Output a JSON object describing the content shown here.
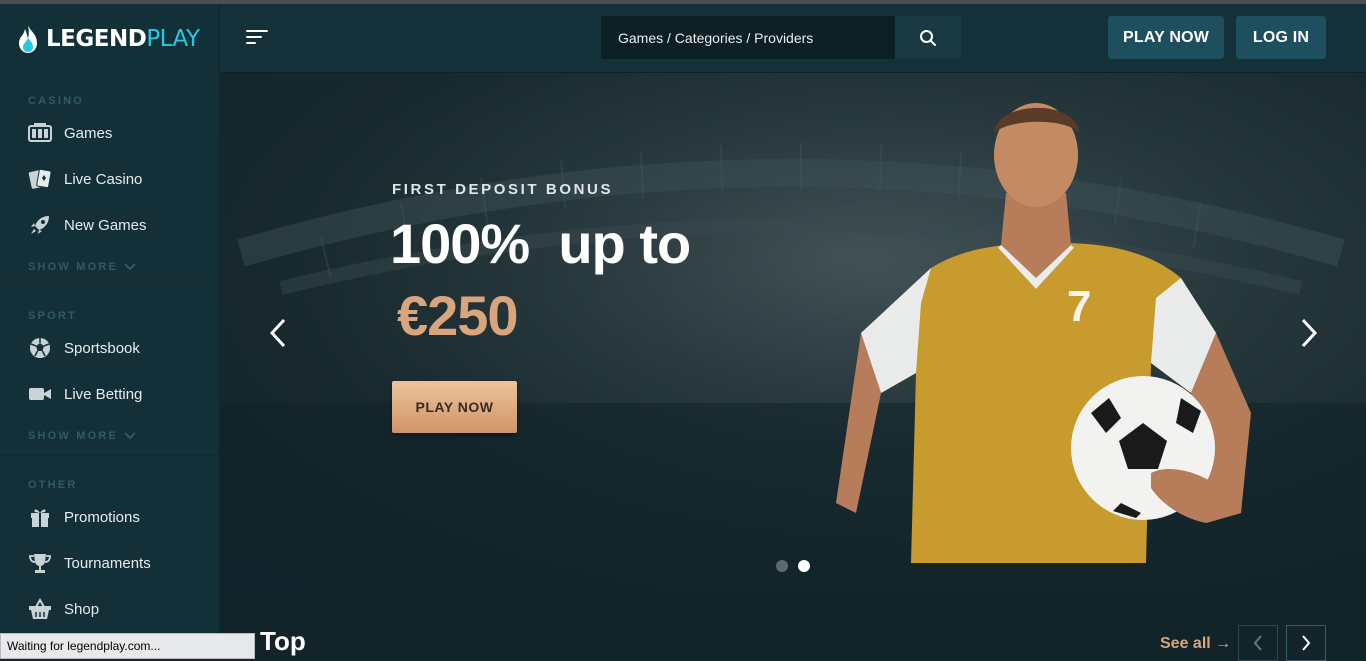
{
  "brand": {
    "name_part1": "LEGEND",
    "name_part2": "PLAY",
    "accent": "#27c8e6"
  },
  "header": {
    "search_placeholder": "Games / Categories / Providers",
    "play_now": "PLAY NOW",
    "log_in": "LOG IN"
  },
  "sidebar": {
    "casino": {
      "label": "CASINO",
      "items": [
        {
          "label": "Games",
          "icon": "slot-machine-icon"
        },
        {
          "label": "Live Casino",
          "icon": "cards-icon"
        },
        {
          "label": "New Games",
          "icon": "rocket-icon"
        }
      ],
      "show_more": "SHOW MORE"
    },
    "sport": {
      "label": "SPORT",
      "items": [
        {
          "label": "Sportsbook",
          "icon": "soccer-ball-icon"
        },
        {
          "label": "Live Betting",
          "icon": "video-camera-icon"
        }
      ],
      "show_more": "SHOW MORE"
    },
    "other": {
      "label": "OTHER",
      "items": [
        {
          "label": "Promotions",
          "icon": "gift-icon"
        },
        {
          "label": "Tournaments",
          "icon": "trophy-icon"
        },
        {
          "label": "Shop",
          "icon": "basket-icon"
        }
      ]
    }
  },
  "hero": {
    "label": "FIRST DEPOSIT BONUS",
    "title": "100%  up to",
    "amount": "€250",
    "cta": "PLAY NOW",
    "jersey_number": "7",
    "amount_color": "#d8a57c",
    "slides": 2,
    "active_slide": 2
  },
  "section": {
    "title": "Top",
    "see_all": "See all →"
  },
  "status_bar": "Waiting for legendplay.com..."
}
